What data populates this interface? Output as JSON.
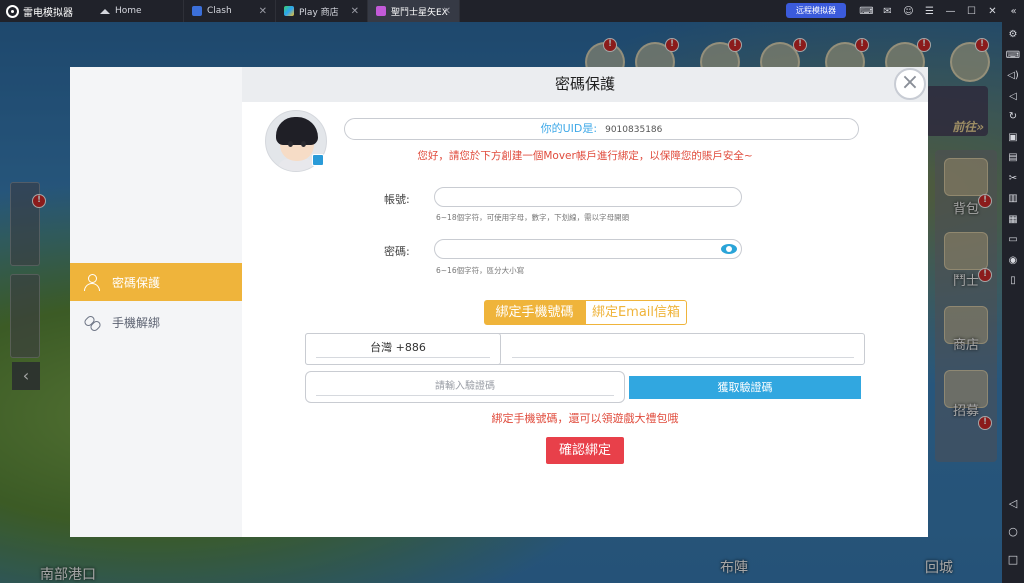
{
  "emulator": {
    "app_name": "雷电模拟器",
    "tabs": [
      {
        "label": "Home"
      },
      {
        "label": "Clash"
      },
      {
        "label": "Play 商店"
      },
      {
        "label": "聖鬥士星矢EX"
      }
    ],
    "remote_label": "远程模拟器"
  },
  "game": {
    "labels": {
      "port": "南部港口",
      "bag": "背包",
      "fighter": "鬥士",
      "shop": "商店",
      "recruit": "招募",
      "formation": "布陣",
      "city": "回城",
      "goto": "前往»"
    }
  },
  "dialog": {
    "title": "密碼保護",
    "sidebar": [
      {
        "label": "密碼保護",
        "icon": "person-icon",
        "active": true
      },
      {
        "label": "手機解綁",
        "icon": "unlink-icon",
        "active": false
      }
    ],
    "uid_label": "你的UID是:",
    "uid_value": "9010835186",
    "notice": "您好，請您於下方創建一個Mover帳戶進行綁定，以保障您的賬戶安全~",
    "account": {
      "label": "帳號:",
      "value": "",
      "hint": "6~18個字符，可使用字母，數字，下划線，需以字母開頭"
    },
    "password": {
      "label": "密碼:",
      "value": "",
      "hint": "6~16個字符，區分大小寫"
    },
    "bind_tabs": {
      "phone": "綁定手機號碼",
      "email": "綁定Email信箱",
      "active": "phone"
    },
    "country_code": "台灣 +886",
    "phone_value": "",
    "code_placeholder": "請輸入驗證碼",
    "get_code_label": "獲取驗證碼",
    "gift_text": "綁定手機號碼，還可以領遊戲大禮包哦",
    "confirm_label": "確認綁定"
  },
  "colors": {
    "accent_gold": "#efb43b",
    "accent_blue": "#31a7e0",
    "warning_red": "#e04b3c",
    "confirm_red": "#e8404a"
  }
}
